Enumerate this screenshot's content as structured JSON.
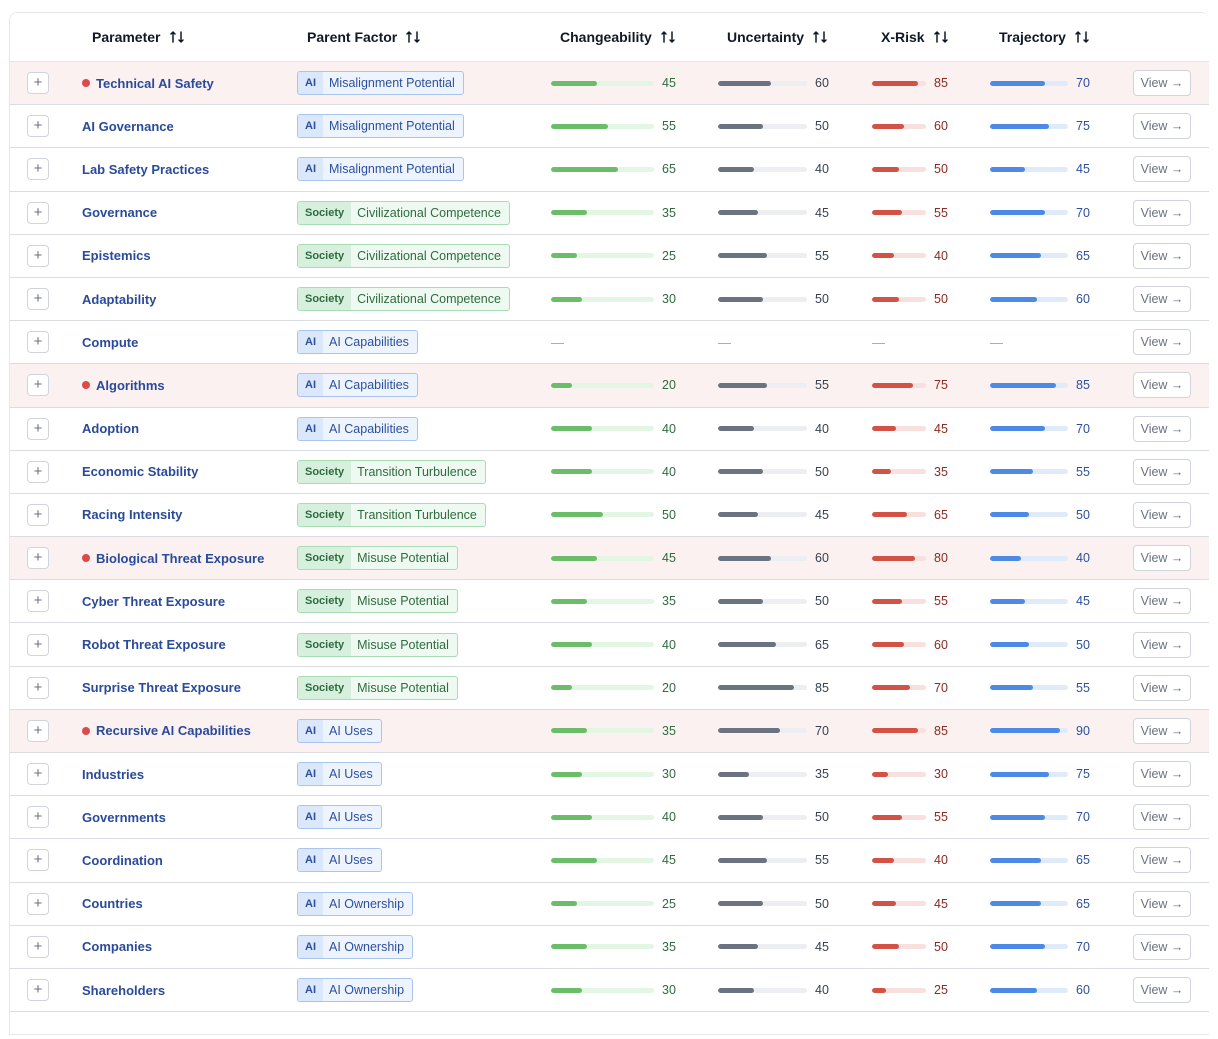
{
  "header": {
    "parameter": "Parameter",
    "parent_factor": "Parent Factor",
    "changeability": "Changeability",
    "uncertainty": "Uncertainty",
    "xrisk": "X-Risk",
    "trajectory": "Trajectory"
  },
  "expand_label": "+",
  "view_label": "View →",
  "dash": "—",
  "colors": {
    "changeability": "#6cbd6a",
    "changeability_track": "#e3f5e3",
    "changeability_text": "#2f6b3f",
    "uncertainty": "#6b7280",
    "uncertainty_track": "#eceef1",
    "uncertainty_text": "#374151",
    "xrisk": "#d35246",
    "xrisk_track": "#f7e0de",
    "xrisk_text": "#8a2a20",
    "trajectory": "#4d8ae6",
    "trajectory_track": "#e0ebfa",
    "trajectory_text": "#2c4f9e",
    "flag_row": "#fcf1f1"
  },
  "rows": [
    {
      "name": "Technical AI Safety",
      "flag": true,
      "tag": "AI",
      "factor": "Misalignment Potential",
      "c": 45,
      "u": 60,
      "x": 85,
      "t": 70
    },
    {
      "name": "AI Governance",
      "flag": false,
      "tag": "AI",
      "factor": "Misalignment Potential",
      "c": 55,
      "u": 50,
      "x": 60,
      "t": 75
    },
    {
      "name": "Lab Safety Practices",
      "flag": false,
      "tag": "AI",
      "factor": "Misalignment Potential",
      "c": 65,
      "u": 40,
      "x": 50,
      "t": 45
    },
    {
      "name": "Governance",
      "flag": false,
      "tag": "Society",
      "factor": "Civilizational Competence",
      "c": 35,
      "u": 45,
      "x": 55,
      "t": 70
    },
    {
      "name": "Epistemics",
      "flag": false,
      "tag": "Society",
      "factor": "Civilizational Competence",
      "c": 25,
      "u": 55,
      "x": 40,
      "t": 65
    },
    {
      "name": "Adaptability",
      "flag": false,
      "tag": "Society",
      "factor": "Civilizational Competence",
      "c": 30,
      "u": 50,
      "x": 50,
      "t": 60
    },
    {
      "name": "Compute",
      "flag": false,
      "tag": "AI",
      "factor": "AI Capabilities",
      "c": null,
      "u": null,
      "x": null,
      "t": null
    },
    {
      "name": "Algorithms",
      "flag": true,
      "tag": "AI",
      "factor": "AI Capabilities",
      "c": 20,
      "u": 55,
      "x": 75,
      "t": 85
    },
    {
      "name": "Adoption",
      "flag": false,
      "tag": "AI",
      "factor": "AI Capabilities",
      "c": 40,
      "u": 40,
      "x": 45,
      "t": 70
    },
    {
      "name": "Economic Stability",
      "flag": false,
      "tag": "Society",
      "factor": "Transition Turbulence",
      "c": 40,
      "u": 50,
      "x": 35,
      "t": 55
    },
    {
      "name": "Racing Intensity",
      "flag": false,
      "tag": "Society",
      "factor": "Transition Turbulence",
      "c": 50,
      "u": 45,
      "x": 65,
      "t": 50
    },
    {
      "name": "Biological Threat Exposure",
      "flag": true,
      "tag": "Society",
      "factor": "Misuse Potential",
      "c": 45,
      "u": 60,
      "x": 80,
      "t": 40
    },
    {
      "name": "Cyber Threat Exposure",
      "flag": false,
      "tag": "Society",
      "factor": "Misuse Potential",
      "c": 35,
      "u": 50,
      "x": 55,
      "t": 45
    },
    {
      "name": "Robot Threat Exposure",
      "flag": false,
      "tag": "Society",
      "factor": "Misuse Potential",
      "c": 40,
      "u": 65,
      "x": 60,
      "t": 50
    },
    {
      "name": "Surprise Threat Exposure",
      "flag": false,
      "tag": "Society",
      "factor": "Misuse Potential",
      "c": 20,
      "u": 85,
      "x": 70,
      "t": 55
    },
    {
      "name": "Recursive AI Capabilities",
      "flag": true,
      "tag": "AI",
      "factor": "AI Uses",
      "c": 35,
      "u": 70,
      "x": 85,
      "t": 90
    },
    {
      "name": "Industries",
      "flag": false,
      "tag": "AI",
      "factor": "AI Uses",
      "c": 30,
      "u": 35,
      "x": 30,
      "t": 75
    },
    {
      "name": "Governments",
      "flag": false,
      "tag": "AI",
      "factor": "AI Uses",
      "c": 40,
      "u": 50,
      "x": 55,
      "t": 70
    },
    {
      "name": "Coordination",
      "flag": false,
      "tag": "AI",
      "factor": "AI Uses",
      "c": 45,
      "u": 55,
      "x": 40,
      "t": 65
    },
    {
      "name": "Countries",
      "flag": false,
      "tag": "AI",
      "factor": "AI Ownership",
      "c": 25,
      "u": 50,
      "x": 45,
      "t": 65
    },
    {
      "name": "Companies",
      "flag": false,
      "tag": "AI",
      "factor": "AI Ownership",
      "c": 35,
      "u": 45,
      "x": 50,
      "t": 70
    },
    {
      "name": "Shareholders",
      "flag": false,
      "tag": "AI",
      "factor": "AI Ownership",
      "c": 30,
      "u": 40,
      "x": 25,
      "t": 60
    }
  ]
}
